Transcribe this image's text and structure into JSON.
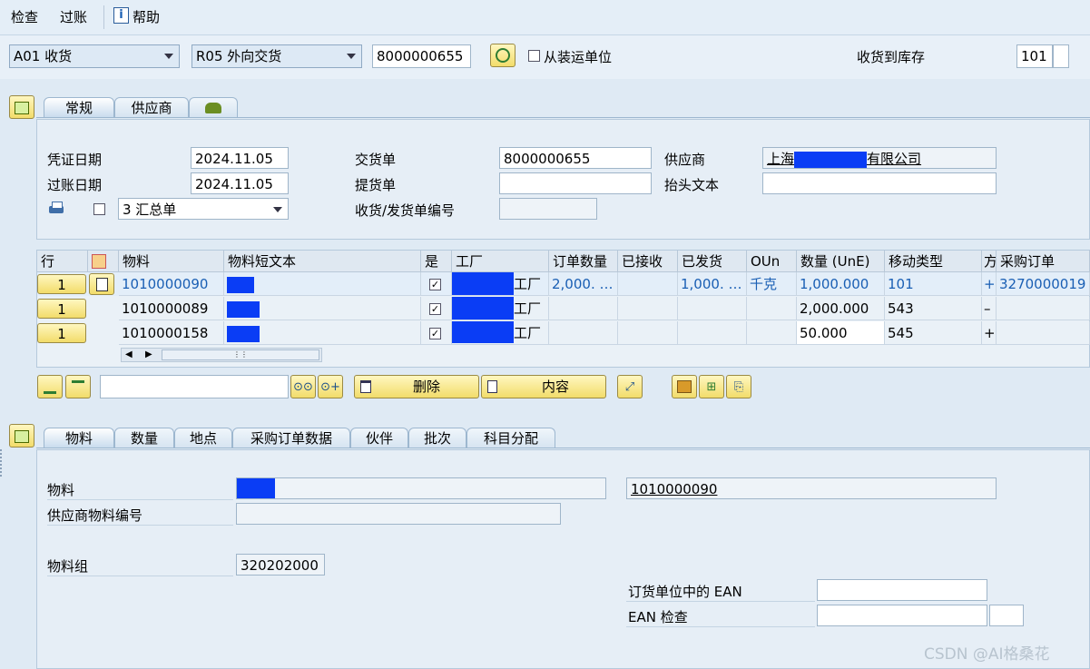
{
  "menu": {
    "items": [
      "检查",
      "过账"
    ],
    "help": "帮助"
  },
  "toolbar": {
    "action_dropdown": "A01 收货",
    "ref_dropdown": "R05 外向交货",
    "doc_number": "8000000655",
    "from_unit_label": "从装运单位",
    "receive_to_label": "收货到库存",
    "movement_type": "101"
  },
  "header_tabs": {
    "general": "常规",
    "vendor": "供应商"
  },
  "header": {
    "doc_date_label": "凭证日期",
    "doc_date": "2024.11.05",
    "post_date_label": "过账日期",
    "post_date": "2024.11.05",
    "print_option": "3 汇总单",
    "delivery_label": "交货单",
    "delivery": "8000000655",
    "bill_label": "提货单",
    "bill": "",
    "gr_slip_label": "收货/发货单编号",
    "gr_slip": "",
    "vendor_label": "供应商",
    "vendor_prefix": "上海",
    "vendor_suffix": "有限公司",
    "header_text_label": "抬头文本",
    "header_text": ""
  },
  "grid": {
    "columns": [
      "行",
      "物料",
      "物料短文本",
      "是",
      "工厂",
      "订单数量",
      "已接收",
      "已发货",
      "OUn",
      "数量 (UnE)",
      "移动类型",
      "方",
      "采购订单"
    ],
    "rows": [
      {
        "line": "1",
        "material": "1010000090",
        "plant_suffix": "工厂",
        "order_qty": "2,000. …",
        "received": "",
        "shipped": "1,000. …",
        "oun": "千克",
        "qty": "1,000.000",
        "mvt": "101",
        "sign": "+",
        "po": "3270000019"
      },
      {
        "line": "1",
        "material": "1010000089",
        "plant_suffix": "工厂",
        "order_qty": "",
        "received": "",
        "shipped": "",
        "oun": "",
        "qty": "2,000.000",
        "mvt": "543",
        "sign": "–",
        "po": ""
      },
      {
        "line": "1",
        "material": "1010000158",
        "plant_suffix": "工厂",
        "order_qty": "",
        "received": "",
        "shipped": "",
        "oun": "",
        "qty": "50.000",
        "mvt": "545",
        "sign": "+",
        "po": ""
      }
    ],
    "scroll_dots": "⋮⋮"
  },
  "grid_toolbar": {
    "delete_label": "删除",
    "content_label": "内容",
    "search_value": ""
  },
  "detail_tabs": {
    "material": "物料",
    "quantity": "数量",
    "location": "地点",
    "po_data": "采购订单数据",
    "partner": "伙伴",
    "batch": "批次",
    "account": "科目分配"
  },
  "detail": {
    "material_label": "物料",
    "material_number": "1010000090",
    "vendor_material_label": "供应商物料编号",
    "vendor_material": "",
    "material_group_label": "物料组",
    "material_group": "320202000",
    "ean_unit_label": "订货单位中的  EAN",
    "ean_unit": "",
    "ean_check_label": "EAN 检查",
    "ean_check": ""
  },
  "watermark": "CSDN @AI格桑花",
  "colors": {
    "accent_blue": "#1a5fb4",
    "mask_blue": "#0a3df5",
    "button_yellow": "#f2dc6a"
  }
}
